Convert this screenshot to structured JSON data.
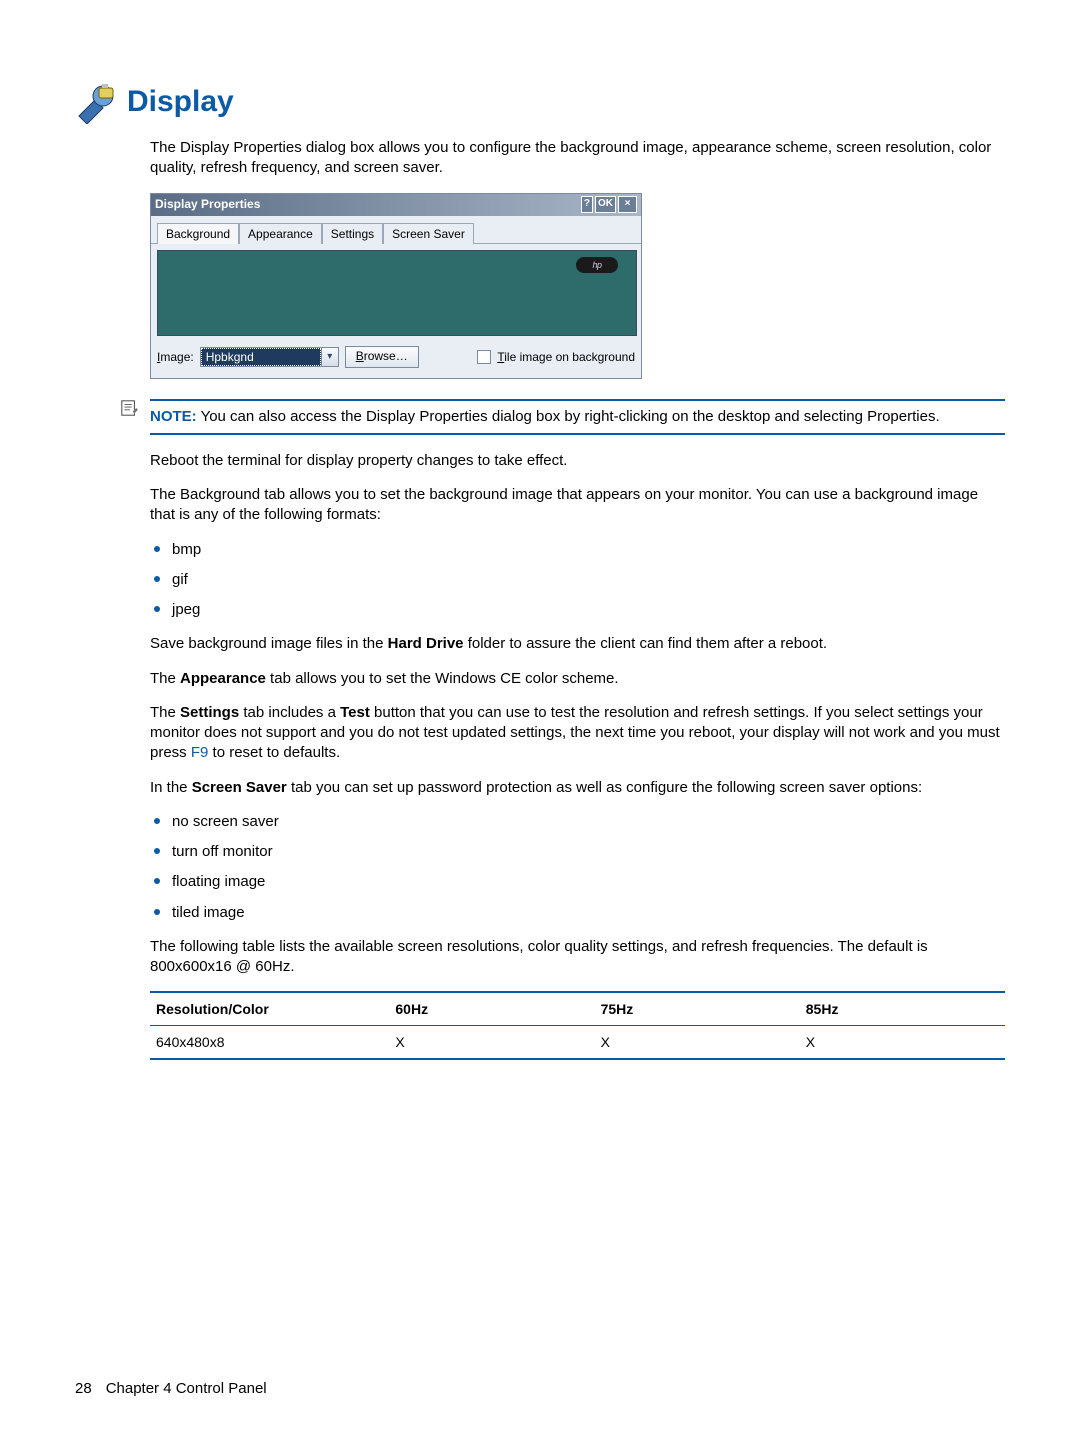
{
  "heading": "Display",
  "intro": "The Display Properties dialog box allows you to configure the background image, appearance scheme, screen resolution, color quality, refresh frequency, and screen saver.",
  "dialog": {
    "title": "Display Properties",
    "titlebar_help": "?",
    "titlebar_ok": "OK",
    "titlebar_close": "×",
    "tabs": [
      "Background",
      "Appearance",
      "Settings",
      "Screen Saver"
    ],
    "active_tab_index": 0,
    "image_label_prefix": "I",
    "image_label_rest": "mage:",
    "image_value": "Hpbkgnd",
    "browse_u": "B",
    "browse_rest": "rowse…",
    "tile_u": "T",
    "tile_rest": "ile image on background",
    "logo_text": "hp"
  },
  "note": {
    "label": "NOTE:",
    "text": "You can also access the Display Properties dialog box by right-clicking on the desktop and selecting Properties."
  },
  "p_reboot": "Reboot the terminal for display property changes to take effect.",
  "p_bg": "The Background tab allows you to set the background image that appears on your monitor. You can use a background image that is any of the following formats:",
  "formats": [
    "bmp",
    "gif",
    "jpeg"
  ],
  "p_save_pre": "Save background image files in the ",
  "p_save_bold": "Hard Drive",
  "p_save_post": " folder to assure the client can find them after a reboot.",
  "p_appearance_pre": "The ",
  "p_appearance_bold": "Appearance",
  "p_appearance_post": " tab allows you to set the Windows CE color scheme.",
  "p_settings_pre": "The ",
  "p_settings_b1": "Settings",
  "p_settings_mid": " tab includes a ",
  "p_settings_b2": "Test",
  "p_settings_post1": " button that you can use to test the resolution and refresh settings. If you select settings your monitor does not support and you do not test updated settings, the next time you reboot, your display will not work and you must press ",
  "p_settings_link": "F9",
  "p_settings_post2": " to reset to defaults.",
  "p_ss_pre": "In the ",
  "p_ss_bold": "Screen Saver",
  "p_ss_post": " tab you can set up password protection as well as configure the following screen saver options:",
  "ss_options": [
    "no screen saver",
    "turn off monitor",
    "floating image",
    "tiled image"
  ],
  "p_table_intro": "The following table lists the available screen resolutions, color quality settings, and refresh frequencies. The default is 800x600x16 @ 60Hz.",
  "table": {
    "headers": [
      "Resolution/Color",
      "60Hz",
      "75Hz",
      "85Hz"
    ],
    "rows": [
      {
        "label": "640x480x8",
        "c60": "X",
        "c75": "X",
        "c85": "X"
      }
    ]
  },
  "footer": {
    "page": "28",
    "chapter": "Chapter 4   Control Panel"
  }
}
